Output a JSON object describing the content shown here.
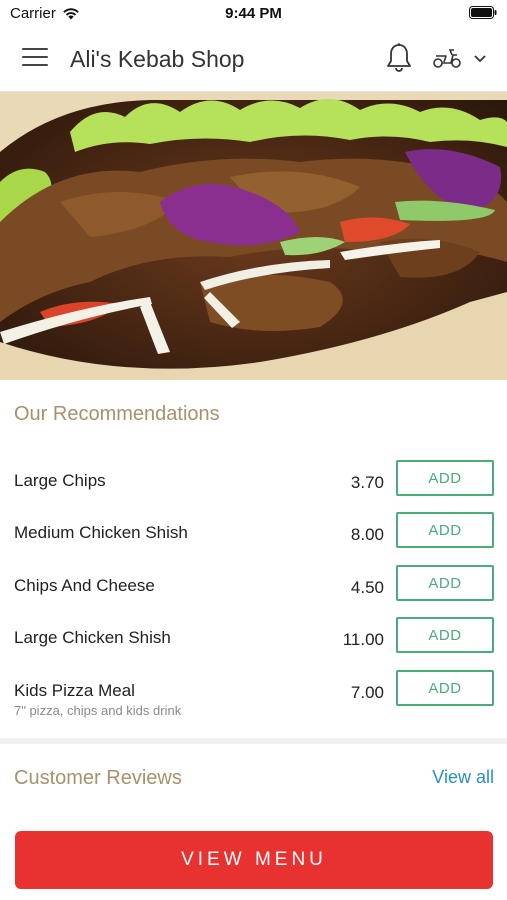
{
  "status_bar": {
    "carrier": "Carrier",
    "time": "9:44 PM"
  },
  "header": {
    "title": "Ali's Kebab Shop",
    "icons": [
      "hamburger-menu-icon",
      "bell-icon",
      "scooter-icon",
      "chevron-down-icon"
    ]
  },
  "hero": {
    "image": "doner-kebab-photo"
  },
  "recommendations": {
    "title": "Our Recommendations",
    "items": [
      {
        "name": "Large Chips",
        "price": "3.70",
        "button": "ADD",
        "description": ""
      },
      {
        "name": "Medium Chicken Shish",
        "price": "8.00",
        "button": "ADD",
        "description": ""
      },
      {
        "name": "Chips And Cheese",
        "price": "4.50",
        "button": "ADD",
        "description": ""
      },
      {
        "name": "Large Chicken Shish",
        "price": "11.00",
        "button": "ADD",
        "description": ""
      },
      {
        "name": "Kids Pizza Meal",
        "price": "7.00",
        "button": "ADD",
        "description": "7\" pizza, chips and kids drink"
      }
    ]
  },
  "reviews": {
    "title": "Customer Reviews",
    "view_all": "View all"
  },
  "footer": {
    "view_menu": "VIEW MENU"
  },
  "colors": {
    "accent_green": "#4bab7b",
    "section_title": "#a8916b",
    "link_blue": "#2a8fc4",
    "primary_red": "#e8322f"
  }
}
